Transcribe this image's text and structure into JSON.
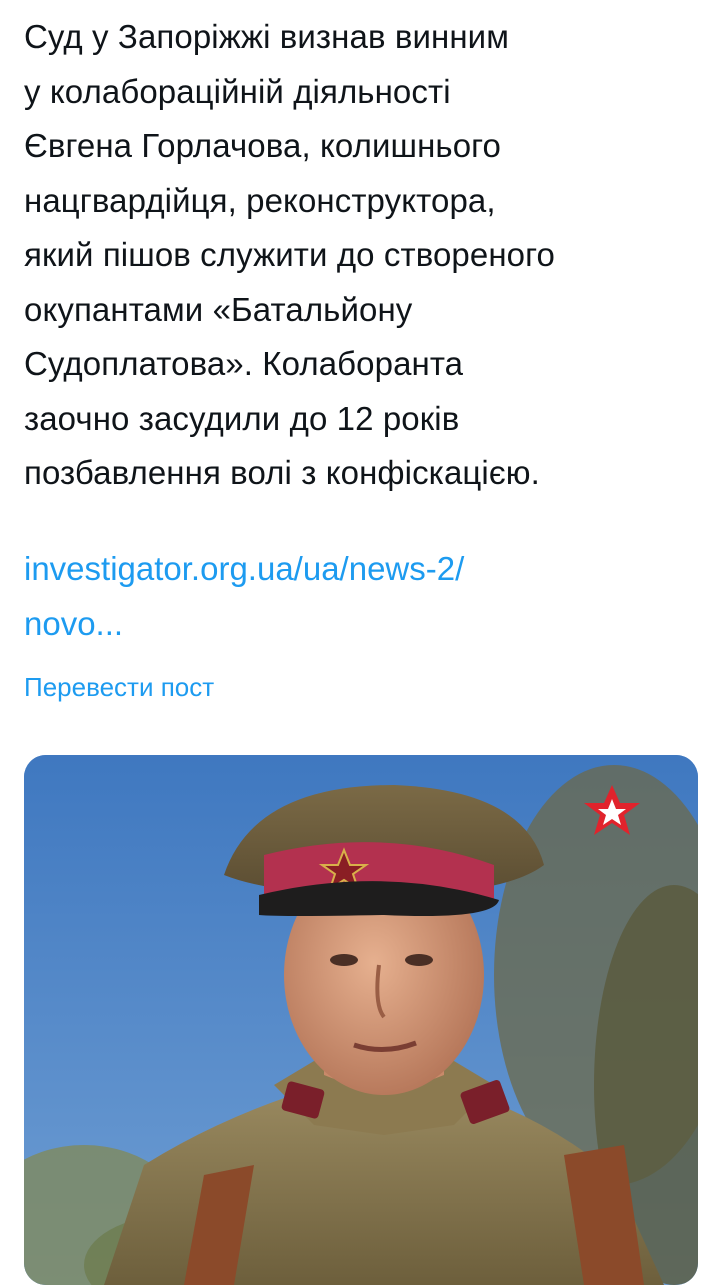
{
  "post": {
    "text_lines": [
      "Суд у Запоріжжі визнав винним",
      "у колабораційній діяльності",
      "Євгена Горлачова, колишнього",
      "нацгвардійця, реконструктора,",
      "який пішов служити до створеного",
      "окупантами «Батальйону",
      "Судоплатова». Колаборанта",
      "заочно засудили до 12 років",
      "позбавлення волі з конфіскацією."
    ],
    "link_lines": [
      "investigator.org.ua/ua/news-2/",
      "novo..."
    ],
    "translate_label": "Перевести пост"
  },
  "media": {
    "description_icon": "photo-man-in-uniform-with-cap",
    "watermark_icon": "zvezda-star-logo",
    "colors": {
      "sky": "#4f83c4",
      "cap_band": "#b3314f",
      "tunic": "#8a7a52",
      "strap": "#8b4a2a",
      "watermark": "#e1232c"
    }
  }
}
